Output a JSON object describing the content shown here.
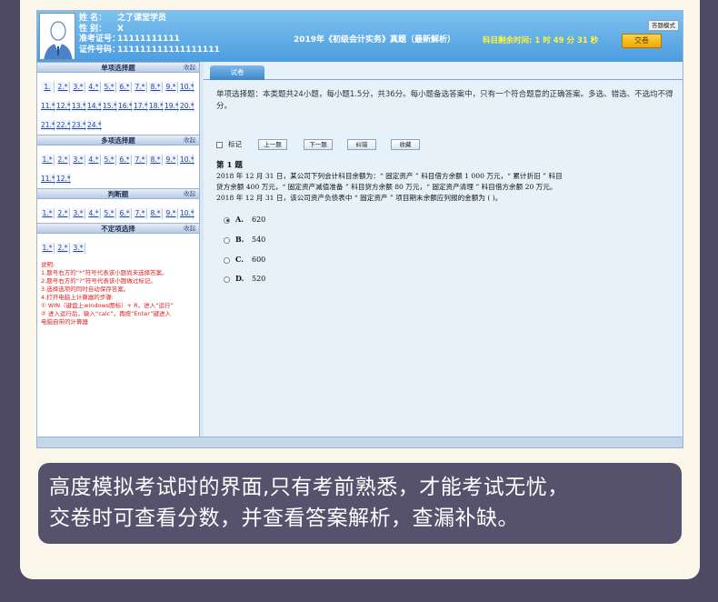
{
  "header": {
    "candidate": [
      {
        "label": "姓    名：",
        "value": "之了课堂学员"
      },
      {
        "label": "性    别：",
        "value": "X"
      },
      {
        "label": "准考证号：",
        "value": "11111111111"
      },
      {
        "label": "证件号码：",
        "value": "111111111111111111"
      }
    ],
    "exam_title": "2019年《初级会计实务》真题（最新解析）",
    "timer_label": "科目剩余时间:",
    "timer_value": "1 时 49 分 31 秒",
    "mode_button": "答题模式",
    "submit_button": "交卷"
  },
  "left_panel": {
    "fold_label": "收起",
    "sections": [
      {
        "title": "单项选择题",
        "questions": [
          "1.",
          "2.*",
          "3.*",
          "4.*",
          "5.*",
          "6.*",
          "7.*",
          "8.*",
          "9.*",
          "10.*",
          "11.*",
          "12.*",
          "13.*",
          "14.*",
          "15.*",
          "16.*",
          "17.*",
          "18.*",
          "19.*",
          "20.*",
          "21.*",
          "22.*",
          "23.*",
          "24.*"
        ]
      },
      {
        "title": "多项选择题",
        "questions": [
          "1.*",
          "2.*",
          "3.*",
          "4.*",
          "5.*",
          "6.*",
          "7.*",
          "8.*",
          "9.*",
          "10.*",
          "11.*",
          "12.*"
        ]
      },
      {
        "title": "判断题",
        "questions": [
          "1.*",
          "2.*",
          "3.*",
          "4.*",
          "5.*",
          "6.*",
          "7.*",
          "8.*",
          "9.*",
          "10.*"
        ]
      },
      {
        "title": "不定项选择",
        "questions": [
          "1.*",
          "2.*",
          "3.*"
        ]
      }
    ],
    "notes": [
      "说明:",
      "1.题号右方的“*”符号代表该小题尚未选择答案。",
      "2.题号右方的“?”符号代表该小题做过标记。",
      "3.选择选项的同时自动保存答案。",
      "4.打开电脑上计算器的步骤:",
      "① WIN（键盘上windows图标）+ R，进入“运行”",
      "② 进入运行后，输入“calc”，再按“Enter”键进入",
      "电脑自带的计算器"
    ]
  },
  "right_panel": {
    "tab": "试卷",
    "intro": "单项选择题：本类题共24小题，每小题1.5分，共36分。每小题备选答案中，只有一个符合题意的正确答案。多选、错选、不选均不得分。",
    "mark_label": "标记",
    "buttons": {
      "prev": "上一题",
      "next": "下一题",
      "correct": "纠错",
      "favorite": "收藏"
    },
    "question_number": "第 1 题",
    "question_lines": [
      "2018 年 12 月 31 日，某公司下列会计科目余额为：“ 固定资产 ” 科目借方余额 1 000 万元，“ 累计折旧 ” 科目",
      "贷方余额 400 万元，“ 固定资产减值准备 ” 科目贷方余额 80 万元，“ 固定资产清理 ” 科目借方余额 20 万元。",
      "2018 年 12 月 31 日，该公司资产负债表中 “ 固定资产 ” 项目期末余额应列报的金额为 (      )。"
    ],
    "options": [
      {
        "label": "A.",
        "value": "620",
        "selected": true
      },
      {
        "label": "B.",
        "value": "540",
        "selected": false
      },
      {
        "label": "C.",
        "value": "600",
        "selected": false
      },
      {
        "label": "D.",
        "value": "520",
        "selected": false
      }
    ]
  },
  "caption": {
    "line1": "高度模拟考试时的界面,只有考前熟悉，才能考试无忧，",
    "line2": "交卷时可查看分数，并查看答案解析，查漏补缺。"
  }
}
